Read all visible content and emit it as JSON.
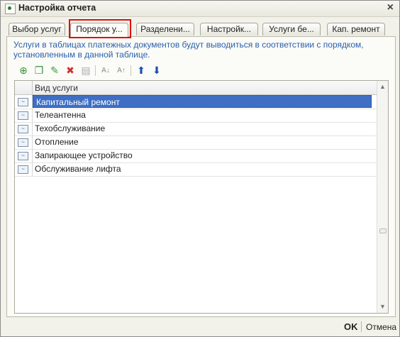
{
  "window": {
    "title": "Настройка отчета",
    "close_icon": "×"
  },
  "tabs": [
    {
      "label": "Выбор услуг"
    },
    {
      "label": "Порядок у..."
    },
    {
      "label": "Разделени..."
    },
    {
      "label": "Настройк..."
    },
    {
      "label": "Услуги бе..."
    },
    {
      "label": "Кап. ремонт"
    }
  ],
  "active_tab": "Порядок у...",
  "panel": {
    "description_line1": "Услуги в таблицах платежных документов будут выводиться в соответствии с порядком,",
    "description_line2": "установленным в данной таблице."
  },
  "toolbar": {
    "add": "⊕",
    "copy": "❐",
    "edit": "✎",
    "delete": "✖",
    "save": "▤",
    "sort_asc": "A↓",
    "sort_desc": "A↑",
    "move_up": "⬆",
    "move_down": "⬇"
  },
  "table": {
    "column_header": "Вид услуги",
    "rows": [
      "Капитальный ремонт",
      "Телеантенна",
      "Техобслуживание",
      "Отопление",
      "Запирающее устройство",
      "Обслуживание лифта"
    ],
    "selected_index": 0
  },
  "footer": {
    "ok_label": "OK",
    "cancel_label": "Отмена"
  },
  "colors": {
    "accent_blue": "#2a5fad",
    "selection": "#3f6fc4",
    "highlight_red": "#e01010"
  }
}
